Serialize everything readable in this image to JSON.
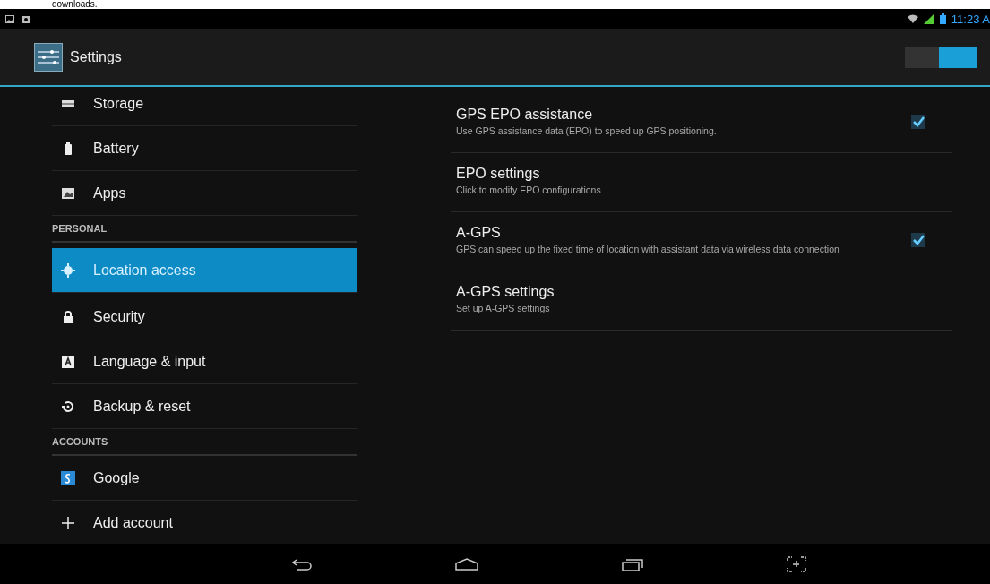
{
  "caption": "downloads.",
  "status_bar": {
    "time": "11:23 A"
  },
  "action_bar": {
    "title": "Settings",
    "switch": {
      "on": true
    }
  },
  "sidebar": {
    "items": [
      {
        "kind": "item",
        "label": "Storage",
        "selected": false
      },
      {
        "kind": "item",
        "label": "Battery",
        "selected": false
      },
      {
        "kind": "item",
        "label": "Apps",
        "selected": false
      },
      {
        "kind": "header",
        "label": "PERSONAL"
      },
      {
        "kind": "item",
        "label": "Location access",
        "selected": true
      },
      {
        "kind": "item",
        "label": "Security",
        "selected": false
      },
      {
        "kind": "item",
        "label": "Language & input",
        "selected": false
      },
      {
        "kind": "item",
        "label": "Backup & reset",
        "selected": false
      },
      {
        "kind": "header",
        "label": "ACCOUNTS"
      },
      {
        "kind": "item",
        "label": "Google",
        "selected": false
      },
      {
        "kind": "item",
        "label": "Add account",
        "selected": false
      }
    ]
  },
  "preferences": [
    {
      "kind": "checkbox",
      "title": "GPS EPO assistance",
      "summary": "Use GPS assistance data (EPO) to speed up GPS positioning.",
      "checked": true
    },
    {
      "kind": "link",
      "title": "EPO settings",
      "summary": "Click to modify EPO configurations"
    },
    {
      "kind": "checkbox",
      "title": "A-GPS",
      "summary": "GPS can speed up the fixed time of location with assistant data via wireless data connection",
      "checked": true
    },
    {
      "kind": "link",
      "title": "A-GPS settings",
      "summary": "Set up A-GPS settings"
    }
  ]
}
